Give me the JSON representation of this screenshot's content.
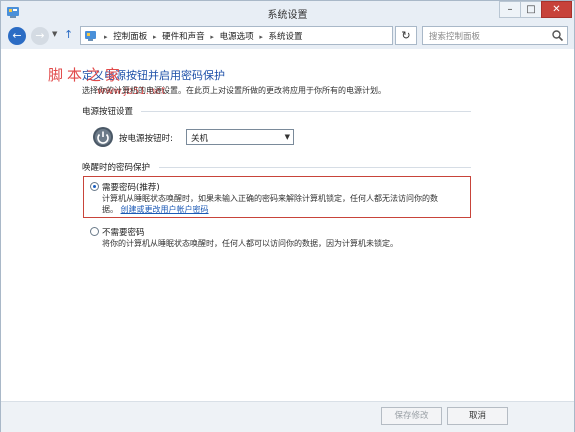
{
  "window": {
    "title": "系统设置",
    "min": "–",
    "max": "□",
    "close": "✕"
  },
  "nav": {
    "back_icon": "arrow-left-icon",
    "forward_icon": "arrow-right-icon",
    "breadcrumbs": [
      "控制面板",
      "硬件和声音",
      "电源选项",
      "系统设置"
    ],
    "refresh": "↻",
    "search_placeholder": "搜索控制面板"
  },
  "watermark": {
    "text": "脚本之家",
    "url": "www.jb51.net"
  },
  "page": {
    "title": "定义电源按钮并启用密码保护",
    "description": "选择你的计算机的电源设置。在此页上对设置所做的更改将应用于你所有的电源计划。"
  },
  "power_buttons": {
    "section_title": "电源按钮设置",
    "label": "按电源按钮时:",
    "value": "关机"
  },
  "password": {
    "section_title": "唤醒时的密码保护",
    "options": [
      {
        "label": "需要密码(推荐)",
        "selected": true,
        "desc_line1": "计算机从睡眠状态唤醒时，如果未输入正确的密码来解除计算机锁定，任何人都无法访问你的数",
        "desc_line2": "据。",
        "link": "创建或更改用户帐户密码"
      },
      {
        "label": "不需要密码",
        "selected": false,
        "desc_line1": "将你的计算机从睡眠状态唤醒时，任何人都可以访问你的数据，因为计算机未锁定。"
      }
    ]
  },
  "footer": {
    "save": "保存修改",
    "cancel": "取消"
  },
  "colors": {
    "accent": "#1c4fa8",
    "highlight_border": "#c8443a",
    "close_button": "#c7423a"
  }
}
